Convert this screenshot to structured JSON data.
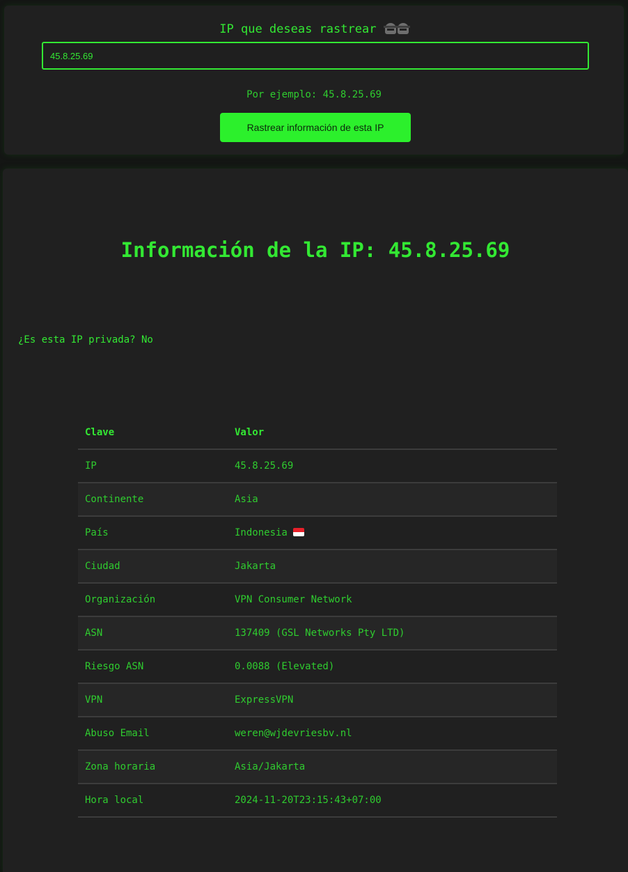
{
  "search": {
    "label": "IP que deseas rastrear",
    "label_icons": [
      "detective-icon",
      "detective-icon"
    ],
    "value": "45.8.25.69",
    "example": "Por ejemplo: 45.8.25.69",
    "button_label": "Rastrear información de esta IP"
  },
  "result": {
    "title": "Información de la IP: 45.8.25.69",
    "private_question": "¿Es esta IP privada? No"
  },
  "table": {
    "headers": [
      "Clave",
      "Valor"
    ],
    "rows": [
      {
        "key": "IP",
        "value": "45.8.25.69"
      },
      {
        "key": "Continente",
        "value": "Asia"
      },
      {
        "key": "País",
        "value": "Indonesia",
        "icon": "indonesia-flag-icon"
      },
      {
        "key": "Ciudad",
        "value": "Jakarta"
      },
      {
        "key": "Organización",
        "value": "VPN Consumer Network"
      },
      {
        "key": "ASN",
        "value": "137409 (GSL Networks Pty LTD)"
      },
      {
        "key": "Riesgo ASN",
        "value": "0.0088 (Elevated)"
      },
      {
        "key": "VPN",
        "value": "ExpressVPN"
      },
      {
        "key": "Abuso Email",
        "value": "weren@wjdevriesbv.nl"
      },
      {
        "key": "Zona horaria",
        "value": "Asia/Jakarta"
      },
      {
        "key": "Hora local",
        "value": "2024-11-20T23:15:43+07:00"
      }
    ]
  },
  "colors": {
    "accent": "#33e833",
    "background": "#141614",
    "card": "#202020",
    "button": "#2cf02c"
  }
}
